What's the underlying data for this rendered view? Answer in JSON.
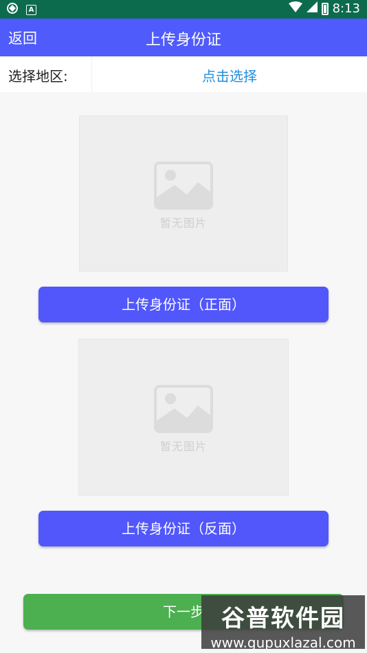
{
  "status_bar": {
    "time": "8:13"
  },
  "app_bar": {
    "back_label": "返回",
    "title": "上传身份证"
  },
  "region": {
    "label": "选择地区:",
    "select_text": "点击选择"
  },
  "front": {
    "placeholder": "暂无图片",
    "button_label": "上传身份证（正面）"
  },
  "back": {
    "placeholder": "暂无图片",
    "button_label": "上传身份证（反面）"
  },
  "next": {
    "label": "下一步"
  },
  "watermark": {
    "main": "谷普软件园",
    "sub": "www.gupuxlazal.com"
  },
  "colors": {
    "primary": "#4f5bfa",
    "status_bar": "#0c6b4d",
    "link": "#1d8fe0",
    "next": "#4caf50"
  }
}
